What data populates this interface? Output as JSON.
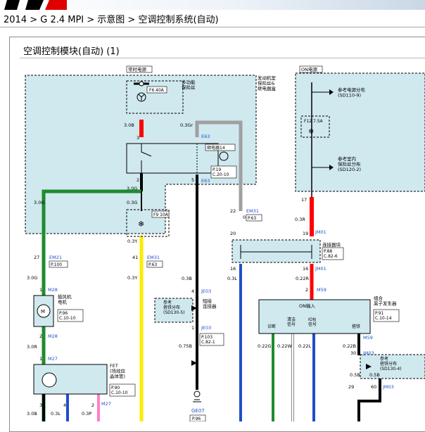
{
  "breadcrumb": "2014 > G 2.4 MPI > 示意图 > 空调控制系统(自动)",
  "panel_title": "空调控制模块(自动) (1)",
  "power": {
    "always": "常时电源",
    "on": "ON电源"
  },
  "boxes": {
    "engine_room": "发动机室\n保险丝&\n继电器盒",
    "multi_fuse": "多功能\n保险丝",
    "relay_14": "继电器14",
    "connector_block": "连接器块",
    "blower_motor": "鼓风机\n电机",
    "fet": "FET\n(场效应\n晶体管)",
    "ground_dist_left": "参考\n搭铁分布\n(SD130-5)",
    "jumper": "短接\n连接器",
    "ion_box": "组合\n离子发生器",
    "on_input": "ON输入",
    "ion_pins": [
      "诊断",
      "清洁\n信号",
      "ION\n信号",
      "搭铁"
    ],
    "power_dist": "参考电源分布\n(SD110-9)",
    "room_fuse_dist": "参考室内\n保险丝分布\n(SD120-2)",
    "ground_dist_right": "参考\n搭铁分布\n(SD130-4)"
  },
  "fuses": {
    "f6": "F6 40A",
    "f9": "F9 10A",
    "f12": "F12 7.5A"
  },
  "connectors": {
    "E63": "E63",
    "EM31": "EM31",
    "EM21": "EM21",
    "JM01": "JM01",
    "M28": "M28",
    "M27": "M27",
    "JE03": "JE03",
    "M59": "M59",
    "JM03": "JM03",
    "GE07": "GE07"
  },
  "page_refs": {
    "p19": "P.19\nC.20-10",
    "p63": "P.63",
    "p100": "P.100",
    "p96": "P.96\nC.10-10",
    "p90": "P.90\nC.10-10",
    "p88": "P.88\nC.82-6",
    "p103": "P.103\nC.82-1",
    "p91": "P.91\nC.10-14",
    "p96b": "P.96"
  },
  "wires": {
    "w30B": "3.0B",
    "w03Gr": "0.3Gr",
    "w30G": "3.0G",
    "w03G": "0.3G",
    "w03Y": "0.3Y",
    "w03R": "0.3R",
    "w03B": "0.3B",
    "w03L": "0.3L",
    "w022R": "0.22R",
    "w075B": "0.75B",
    "w022G": "0.22G",
    "w022W": "0.22W",
    "w022L": "0.22L",
    "w022B": "0.22B",
    "w05B": "0.5B",
    "w03P": "0.3P",
    "w30R": "3.0R",
    "w30G2": "3.0\nG"
  },
  "pins": [
    "3",
    "2",
    "5",
    "22",
    "20",
    "16",
    "17",
    "19",
    "27",
    "41",
    "4",
    "1",
    "2",
    "30",
    "29",
    "60",
    "3",
    "4",
    "2",
    "1"
  ],
  "colors": {
    "engine_bg": "#cfe9ef",
    "red": "#ff0000",
    "green": "#1e8c2e",
    "yellow": "#ffea00",
    "black": "#000000",
    "blue": "#1f4fc7",
    "gray": "#a0a0a0",
    "pink": "#ff7fc7",
    "white": "#ffffff",
    "link": "#1f4fc7"
  }
}
